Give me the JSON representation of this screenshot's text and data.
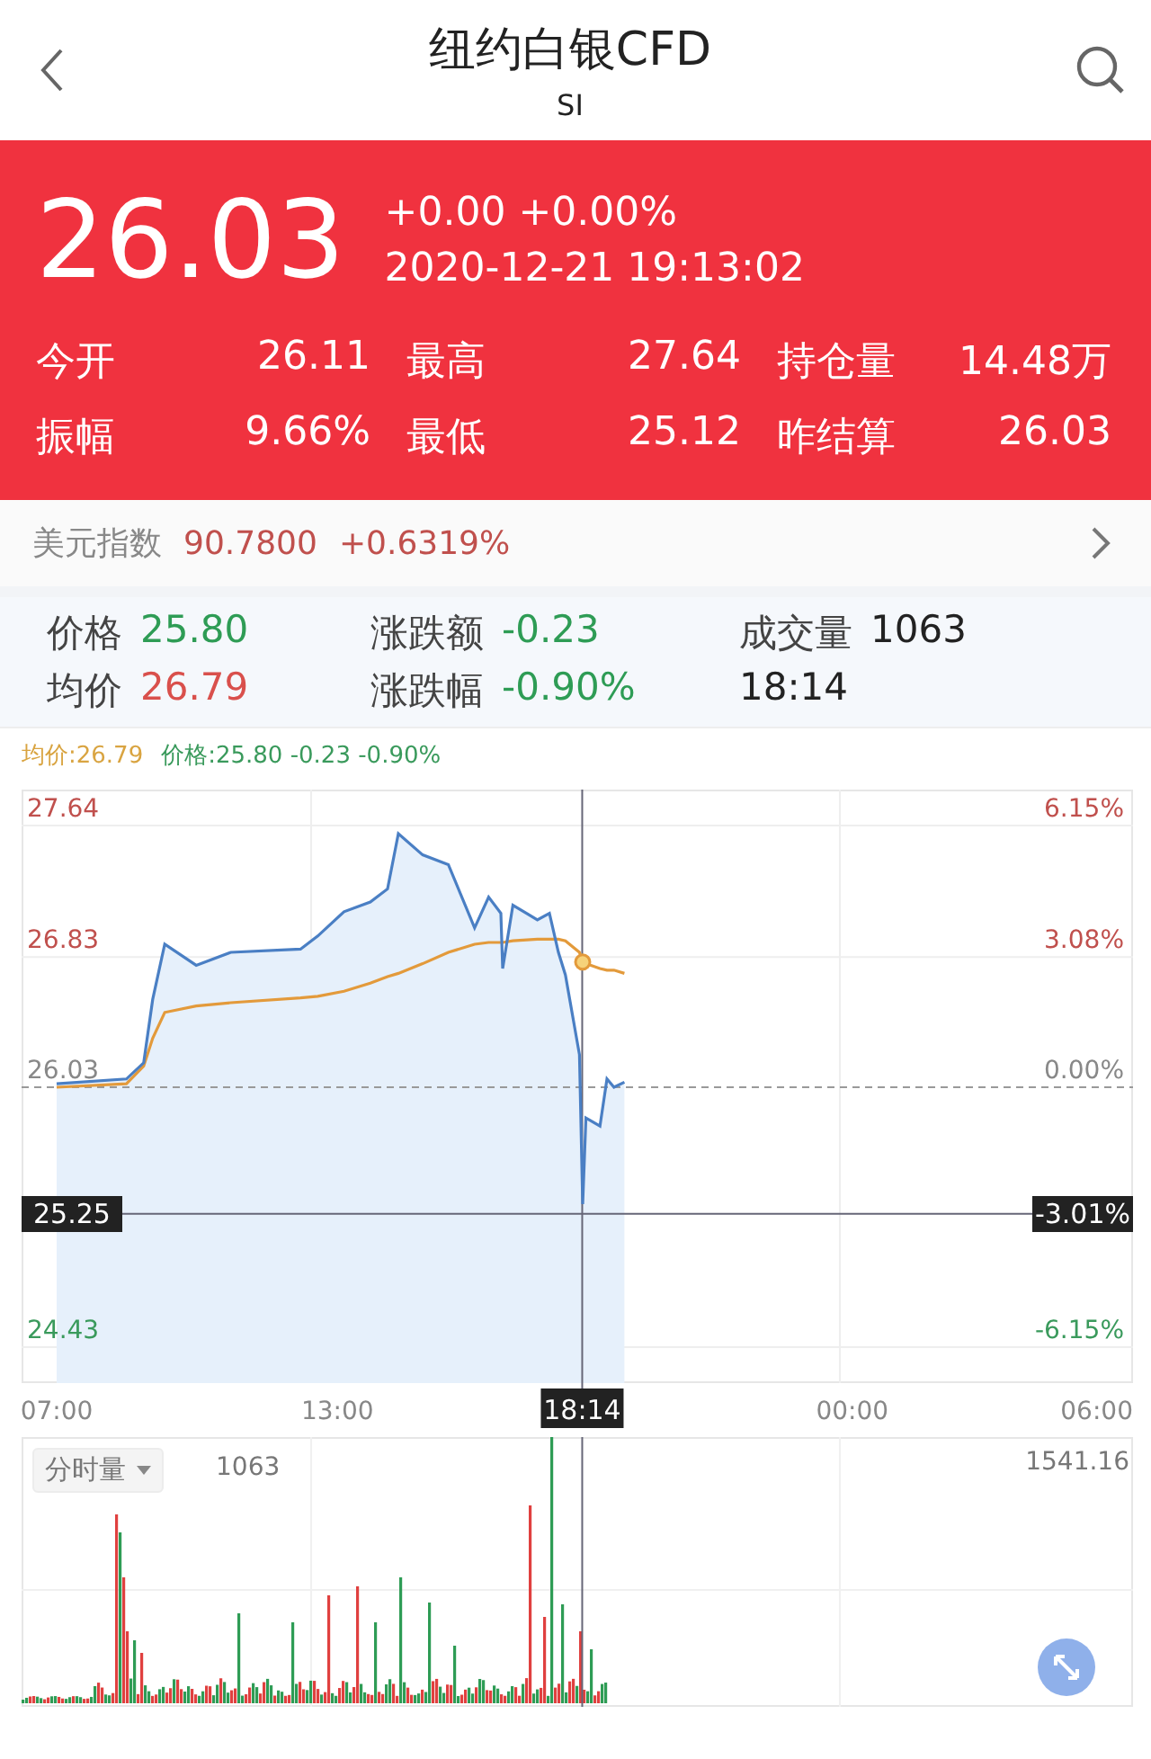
{
  "header": {
    "title": "纽约白银CFD",
    "subtitle": "SI"
  },
  "quote": {
    "price": "26.03",
    "change": "+0.00",
    "change_pct": "+0.00%",
    "time": "2020-12-21 19:13:02",
    "stats": [
      {
        "label": "今开",
        "value": "26.11"
      },
      {
        "label": "最高",
        "value": "27.64"
      },
      {
        "label": "持仓量",
        "value": "14.48万"
      },
      {
        "label": "振幅",
        "value": "9.66%"
      },
      {
        "label": "最低",
        "value": "25.12"
      },
      {
        "label": "昨结算",
        "value": "26.03"
      }
    ]
  },
  "index_bar": {
    "name": "美元指数",
    "value": "90.7800",
    "change": "+0.6319%"
  },
  "details": [
    {
      "label": "价格",
      "value": "25.80",
      "color": "#2e9c55"
    },
    {
      "label": "涨跌额",
      "value": "-0.23",
      "color": "#2e9c55"
    },
    {
      "label": "成交量",
      "value": "1063",
      "color": "#222222"
    },
    {
      "label": "均价",
      "value": "26.79",
      "color": "#d9504c"
    },
    {
      "label": "涨跌幅",
      "value": "-0.90%",
      "color": "#2e9c55"
    },
    {
      "value": "18:14",
      "color": "#222222"
    }
  ],
  "price_chart": {
    "legend": [
      {
        "text": "均价:26.79",
        "color": "#d9a441"
      },
      {
        "text": "价格:25.80 -0.23 -0.90%",
        "color": "#3a9a5c"
      }
    ],
    "chart_data": {
      "type": "line",
      "x": [
        7,
        8.49,
        8.86,
        9.05,
        9.31,
        9.98,
        10.72,
        12.21,
        12.58,
        13.14,
        13.7,
        14.07,
        14.3,
        14.82,
        15.37,
        15.93,
        16.23,
        16.49,
        16.53,
        16.75,
        17.27,
        17.53,
        17.72,
        17.87,
        18.17,
        18.24,
        18.31,
        18.61,
        18.76,
        18.91,
        19.13
      ],
      "series": [
        {
          "color": "#e39a3b",
          "values": [
            26.03,
            26.05,
            26.16,
            26.33,
            26.49,
            26.53,
            26.55,
            26.58,
            26.59,
            26.62,
            26.67,
            26.71,
            26.73,
            26.79,
            26.86,
            26.91,
            26.92,
            26.92,
            26.92,
            26.93,
            26.94,
            26.94,
            26.94,
            26.93,
            26.86,
            26.8,
            26.79,
            26.76,
            26.75,
            26.75,
            26.73
          ]
        },
        {
          "color": "#4a7fc4",
          "values": [
            26.05,
            26.08,
            26.18,
            26.57,
            26.91,
            26.78,
            26.86,
            26.88,
            26.96,
            27.11,
            27.17,
            27.25,
            27.59,
            27.46,
            27.4,
            27.01,
            27.2,
            27.1,
            26.76,
            27.15,
            27.06,
            27.1,
            26.86,
            26.72,
            26.23,
            25.31,
            25.84,
            25.79,
            26.08,
            26.03,
            26.06
          ]
        }
      ],
      "ref_lines": [
        {
          "axis": "y",
          "value": 26.03,
          "color": "#999999"
        },
        {
          "axis": "x",
          "value": 18.23,
          "color": "#666677"
        },
        {
          "axis": "y",
          "value": 25.25,
          "color": "#666677"
        }
      ],
      "xlim": [
        6.25,
        30
      ],
      "ylim": [
        24.43,
        27.64
      ],
      "xticks": [
        {
          "value": 7,
          "label": "07:00"
        },
        {
          "value": 13,
          "label": "13:00"
        }
      ],
      "yticks": [
        {
          "value": 27.64,
          "label": "27.64"
        },
        {
          "value": 26.83,
          "label": "26.83"
        },
        {
          "value": 26.03,
          "label": "26.03"
        },
        {
          "value": 24.43,
          "label": "24.43"
        }
      ]
    },
    "left_ticks": [
      {
        "color": "#c0504d"
      },
      {
        "color": "#c0504d"
      },
      {
        "color": "#888888"
      },
      {
        "color": "#3a9a5c"
      }
    ],
    "right_ticks": [
      {
        "text": "6.15%",
        "color": "#c0504d"
      },
      {
        "text": "3.08%",
        "color": "#c0504d"
      },
      {
        "text": "0.00%",
        "color": "#888888"
      },
      {
        "text": "-6.15%",
        "color": "#3a9a5c"
      }
    ],
    "next_day_labels": [
      "00:00",
      "06:00"
    ],
    "crosshair": {
      "price": "25.25",
      "pct": "-3.01%",
      "time": "18:14"
    }
  },
  "volume": {
    "selector": "分时量",
    "value": "1063",
    "max": "1541.16"
  }
}
